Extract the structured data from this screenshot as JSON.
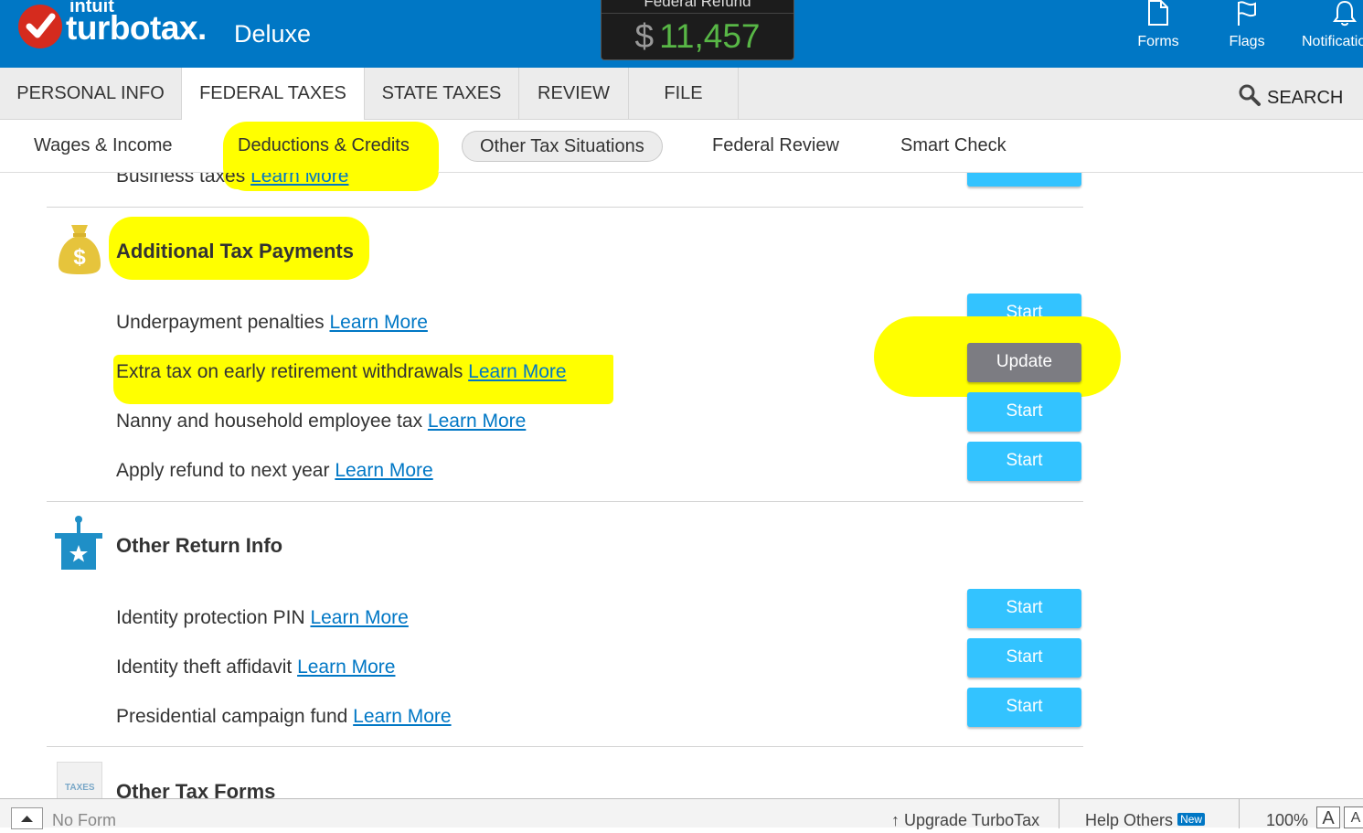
{
  "header": {
    "brand_top": "intuit",
    "brand_main": "turbotax.",
    "brand_edition": "Deluxe",
    "refund_label": "Federal Refund",
    "refund_currency": "$",
    "refund_amount": "11,457",
    "icons": [
      {
        "label": "Forms",
        "icon": "document-icon"
      },
      {
        "label": "Flags",
        "icon": "flag-icon"
      },
      {
        "label": "Notifications",
        "icon": "bell-icon"
      }
    ]
  },
  "main_nav": {
    "tabs": [
      "PERSONAL INFO",
      "FEDERAL TAXES",
      "STATE TAXES",
      "REVIEW",
      "FILE"
    ],
    "active": "FEDERAL TAXES",
    "search_label": "SEARCH"
  },
  "sub_nav": {
    "tabs": [
      "Wages & Income",
      "Deductions & Credits",
      "Other Tax Situations",
      "Federal Review",
      "Smart Check"
    ],
    "active": "Other Tax Situations"
  },
  "content": {
    "partial_row": {
      "label": "Business taxes",
      "link": "Learn More"
    },
    "sections": [
      {
        "title": "Additional Tax Payments",
        "icon": "money-bag-icon",
        "rows": [
          {
            "label": "Underpayment penalties",
            "link": "Learn More",
            "button": "Start"
          },
          {
            "label": "Extra tax on early retirement withdrawals",
            "link": "Learn More",
            "button": "Update"
          },
          {
            "label": "Nanny and household employee tax",
            "link": "Learn More",
            "button": "Start"
          },
          {
            "label": "Apply refund to next year",
            "link": "Learn More",
            "button": "Start"
          }
        ]
      },
      {
        "title": "Other Return Info",
        "icon": "ballot-box-icon",
        "rows": [
          {
            "label": "Identity protection PIN",
            "link": "Learn More",
            "button": "Start"
          },
          {
            "label": "Identity theft affidavit",
            "link": "Learn More",
            "button": "Start"
          },
          {
            "label": "Presidential campaign fund",
            "link": "Learn More",
            "button": "Start"
          }
        ]
      },
      {
        "title": "Other Tax Forms",
        "icon": "taxes-document-icon",
        "icon_text": "TAXES",
        "rows": []
      }
    ]
  },
  "status_bar": {
    "form_label": "No Form",
    "upgrade_label": "Upgrade TurboTax",
    "help_label": "Help Others",
    "help_badge": "New",
    "zoom": "100%",
    "font_a": "A",
    "font_a2": "A"
  },
  "colors": {
    "header_blue": "#0077c5",
    "start_button": "#33c3ff",
    "update_button": "#7c7c82",
    "refund_green": "#58b746",
    "highlight": "#ffff00",
    "link_blue": "#0077c5"
  }
}
